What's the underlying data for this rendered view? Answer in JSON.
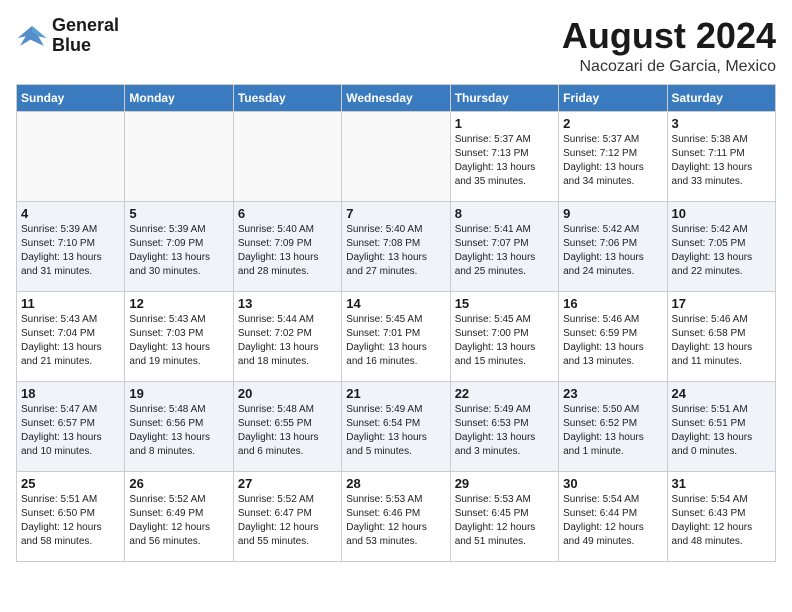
{
  "header": {
    "logo": {
      "line1": "General",
      "line2": "Blue"
    },
    "title": "August 2024",
    "location": "Nacozari de Garcia, Mexico"
  },
  "days_of_week": [
    "Sunday",
    "Monday",
    "Tuesday",
    "Wednesday",
    "Thursday",
    "Friday",
    "Saturday"
  ],
  "weeks": [
    [
      {
        "day": "",
        "info": ""
      },
      {
        "day": "",
        "info": ""
      },
      {
        "day": "",
        "info": ""
      },
      {
        "day": "",
        "info": ""
      },
      {
        "day": "1",
        "info": "Sunrise: 5:37 AM\nSunset: 7:13 PM\nDaylight: 13 hours\nand 35 minutes."
      },
      {
        "day": "2",
        "info": "Sunrise: 5:37 AM\nSunset: 7:12 PM\nDaylight: 13 hours\nand 34 minutes."
      },
      {
        "day": "3",
        "info": "Sunrise: 5:38 AM\nSunset: 7:11 PM\nDaylight: 13 hours\nand 33 minutes."
      }
    ],
    [
      {
        "day": "4",
        "info": "Sunrise: 5:39 AM\nSunset: 7:10 PM\nDaylight: 13 hours\nand 31 minutes."
      },
      {
        "day": "5",
        "info": "Sunrise: 5:39 AM\nSunset: 7:09 PM\nDaylight: 13 hours\nand 30 minutes."
      },
      {
        "day": "6",
        "info": "Sunrise: 5:40 AM\nSunset: 7:09 PM\nDaylight: 13 hours\nand 28 minutes."
      },
      {
        "day": "7",
        "info": "Sunrise: 5:40 AM\nSunset: 7:08 PM\nDaylight: 13 hours\nand 27 minutes."
      },
      {
        "day": "8",
        "info": "Sunrise: 5:41 AM\nSunset: 7:07 PM\nDaylight: 13 hours\nand 25 minutes."
      },
      {
        "day": "9",
        "info": "Sunrise: 5:42 AM\nSunset: 7:06 PM\nDaylight: 13 hours\nand 24 minutes."
      },
      {
        "day": "10",
        "info": "Sunrise: 5:42 AM\nSunset: 7:05 PM\nDaylight: 13 hours\nand 22 minutes."
      }
    ],
    [
      {
        "day": "11",
        "info": "Sunrise: 5:43 AM\nSunset: 7:04 PM\nDaylight: 13 hours\nand 21 minutes."
      },
      {
        "day": "12",
        "info": "Sunrise: 5:43 AM\nSunset: 7:03 PM\nDaylight: 13 hours\nand 19 minutes."
      },
      {
        "day": "13",
        "info": "Sunrise: 5:44 AM\nSunset: 7:02 PM\nDaylight: 13 hours\nand 18 minutes."
      },
      {
        "day": "14",
        "info": "Sunrise: 5:45 AM\nSunset: 7:01 PM\nDaylight: 13 hours\nand 16 minutes."
      },
      {
        "day": "15",
        "info": "Sunrise: 5:45 AM\nSunset: 7:00 PM\nDaylight: 13 hours\nand 15 minutes."
      },
      {
        "day": "16",
        "info": "Sunrise: 5:46 AM\nSunset: 6:59 PM\nDaylight: 13 hours\nand 13 minutes."
      },
      {
        "day": "17",
        "info": "Sunrise: 5:46 AM\nSunset: 6:58 PM\nDaylight: 13 hours\nand 11 minutes."
      }
    ],
    [
      {
        "day": "18",
        "info": "Sunrise: 5:47 AM\nSunset: 6:57 PM\nDaylight: 13 hours\nand 10 minutes."
      },
      {
        "day": "19",
        "info": "Sunrise: 5:48 AM\nSunset: 6:56 PM\nDaylight: 13 hours\nand 8 minutes."
      },
      {
        "day": "20",
        "info": "Sunrise: 5:48 AM\nSunset: 6:55 PM\nDaylight: 13 hours\nand 6 minutes."
      },
      {
        "day": "21",
        "info": "Sunrise: 5:49 AM\nSunset: 6:54 PM\nDaylight: 13 hours\nand 5 minutes."
      },
      {
        "day": "22",
        "info": "Sunrise: 5:49 AM\nSunset: 6:53 PM\nDaylight: 13 hours\nand 3 minutes."
      },
      {
        "day": "23",
        "info": "Sunrise: 5:50 AM\nSunset: 6:52 PM\nDaylight: 13 hours\nand 1 minute."
      },
      {
        "day": "24",
        "info": "Sunrise: 5:51 AM\nSunset: 6:51 PM\nDaylight: 13 hours\nand 0 minutes."
      }
    ],
    [
      {
        "day": "25",
        "info": "Sunrise: 5:51 AM\nSunset: 6:50 PM\nDaylight: 12 hours\nand 58 minutes."
      },
      {
        "day": "26",
        "info": "Sunrise: 5:52 AM\nSunset: 6:49 PM\nDaylight: 12 hours\nand 56 minutes."
      },
      {
        "day": "27",
        "info": "Sunrise: 5:52 AM\nSunset: 6:47 PM\nDaylight: 12 hours\nand 55 minutes."
      },
      {
        "day": "28",
        "info": "Sunrise: 5:53 AM\nSunset: 6:46 PM\nDaylight: 12 hours\nand 53 minutes."
      },
      {
        "day": "29",
        "info": "Sunrise: 5:53 AM\nSunset: 6:45 PM\nDaylight: 12 hours\nand 51 minutes."
      },
      {
        "day": "30",
        "info": "Sunrise: 5:54 AM\nSunset: 6:44 PM\nDaylight: 12 hours\nand 49 minutes."
      },
      {
        "day": "31",
        "info": "Sunrise: 5:54 AM\nSunset: 6:43 PM\nDaylight: 12 hours\nand 48 minutes."
      }
    ]
  ]
}
